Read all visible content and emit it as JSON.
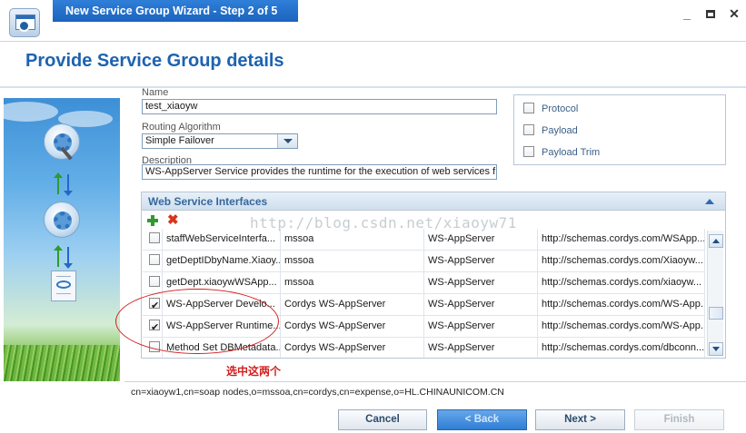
{
  "window": {
    "title": "New Service Group Wizard - Step 2 of 5",
    "controls": {
      "minimize": "_",
      "close": "✕"
    }
  },
  "page": {
    "title": "Provide Service Group details"
  },
  "form": {
    "name_label": "Name",
    "name_value": "test_xiaoyw",
    "routing_label": "Routing Algorithm",
    "routing_value": "Simple Failover",
    "description_label": "Description",
    "description_value": "WS-AppServer Service provides the runtime for the execution of web services f"
  },
  "options": [
    {
      "label": "Protocol",
      "checked": false
    },
    {
      "label": "Payload",
      "checked": false
    },
    {
      "label": "Payload Trim",
      "checked": false
    }
  ],
  "interfaces": {
    "title": "Web Service Interfaces",
    "rows": [
      {
        "checked": false,
        "name": "staffWebServiceInterfa...",
        "org": "mssoa",
        "type": "WS-AppServer",
        "namespace": "http://schemas.cordys.com/WSApp..."
      },
      {
        "checked": false,
        "name": "getDeptIDbyName.Xiaoy...",
        "org": "mssoa",
        "type": "WS-AppServer",
        "namespace": "http://schemas.cordys.com/Xiaoyw..."
      },
      {
        "checked": false,
        "name": "getDept.xiaoywWSApp...",
        "org": "mssoa",
        "type": "WS-AppServer",
        "namespace": "http://schemas.cordys.com/xiaoyw..."
      },
      {
        "checked": true,
        "name": "WS-AppServer Develo...",
        "org": "Cordys WS-AppServer",
        "type": "WS-AppServer",
        "namespace": "http://schemas.cordys.com/WS-App..."
      },
      {
        "checked": true,
        "name": "WS-AppServer Runtime...",
        "org": "Cordys WS-AppServer",
        "type": "WS-AppServer",
        "namespace": "http://schemas.cordys.com/WS-App..."
      },
      {
        "checked": false,
        "name": "Method Set DBMetadata...",
        "org": "Cordys WS-AppServer",
        "type": "WS-AppServer",
        "namespace": "http://schemas.cordys.com/dbconn..."
      }
    ]
  },
  "annotation": {
    "text": "选中这两个",
    "color": "#d21e1e"
  },
  "watermark": "http://blog.csdn.net/xiaoyw71",
  "dn": "cn=xiaoyw1,cn=soap nodes,o=mssoa,cn=cordys,cn=expense,o=HL.CHINAUNICOM.CN",
  "buttons": {
    "cancel": "Cancel",
    "back": "< Back",
    "next": "Next >",
    "finish": "Finish"
  },
  "colors": {
    "accent": "#1c63b0",
    "title_tab": "#2f7fd9",
    "primary_button": "#2f7ed6"
  }
}
